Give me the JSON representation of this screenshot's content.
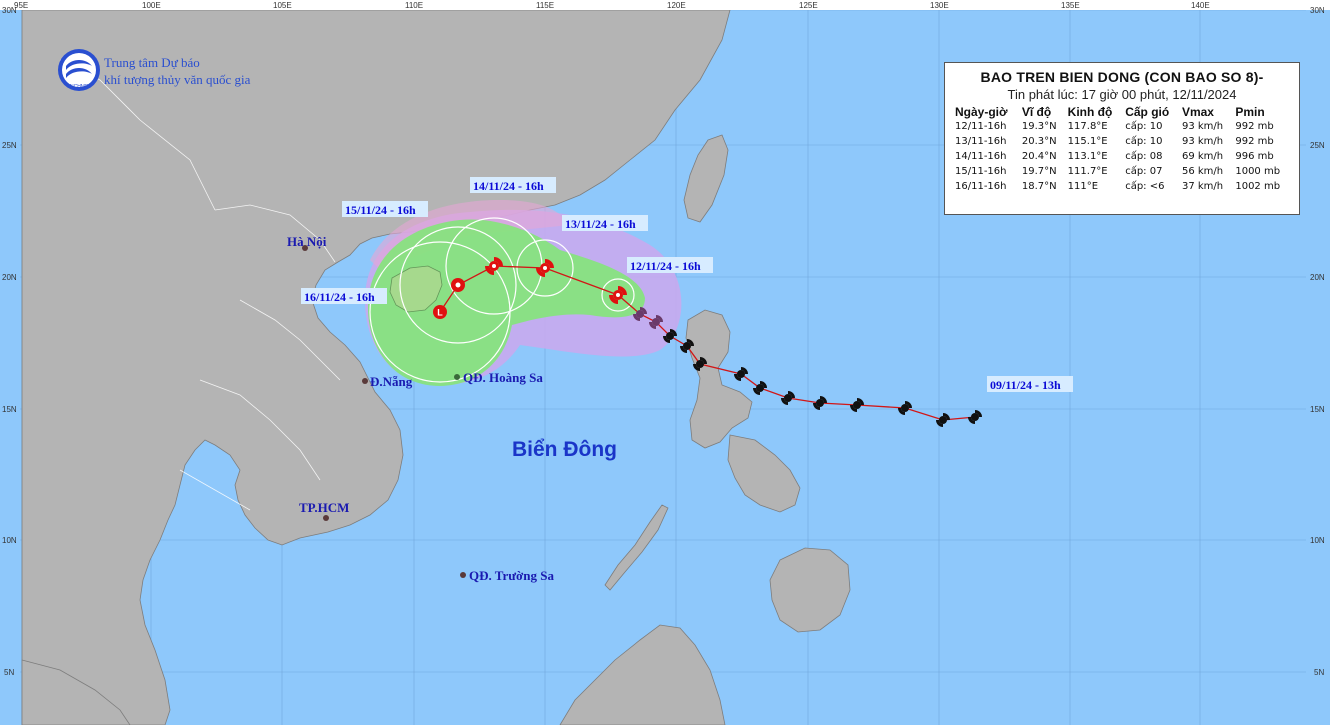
{
  "agency": {
    "line1": "Trung tâm Dự báo",
    "line2": "khí tượng thủy văn quốc gia",
    "logo_text": "NCHMF"
  },
  "info_box": {
    "title": "BAO TREN BIEN DONG (CON BAO SO 8)-",
    "subtitle": "Tin phát lúc: 17 giờ 00 phút, 12/11/2024",
    "headers": [
      "Ngày-giờ",
      "Vĩ độ",
      "Kinh độ",
      "Cấp gió",
      "Vmax",
      "Pmin"
    ],
    "rows": [
      [
        "12/11-16h",
        "19.3°N",
        "117.8°E",
        "cấp: 10",
        "93 km/h",
        "992 mb"
      ],
      [
        "13/11-16h",
        "20.3°N",
        "115.1°E",
        "cấp: 10",
        "93 km/h",
        "992 mb"
      ],
      [
        "14/11-16h",
        "20.4°N",
        "113.1°E",
        "cấp: 08",
        "69 km/h",
        "996 mb"
      ],
      [
        "15/11-16h",
        "19.7°N",
        "111.7°E",
        "cấp: 07",
        "56 km/h",
        "1000 mb"
      ],
      [
        "16/11-16h",
        "18.7°N",
        "111°E",
        "cấp: <6",
        "37 km/h",
        "1002 mb"
      ]
    ]
  },
  "sea_label": "Biển Đông",
  "places": {
    "hanoi": "Hà Nội",
    "danang": "Đ.Nẵng",
    "hoangsa": "QĐ. Hoàng Sa",
    "hcm": "TP.HCM",
    "truongsa": "QĐ. Trường Sa"
  },
  "forecast_labels": {
    "d12": "12/11/24 - 16h",
    "d13": "13/11/24 - 16h",
    "d14": "14/11/24 - 16h",
    "d15": "15/11/24 - 16h",
    "d16": "16/11/24 - 16h",
    "origin": "09/11/24 - 13h"
  },
  "lon_ticks": [
    "95E",
    "100E",
    "105E",
    "110E",
    "115E",
    "120E",
    "125E",
    "130E",
    "135E",
    "140E"
  ],
  "lat_ticks": [
    "30N",
    "25N",
    "20N",
    "15N",
    "10N",
    "5N"
  ],
  "colors": {
    "sea": "#8ec8fb",
    "land": "#b4b4b4",
    "danger_zone": "#c9a8ee",
    "wind_zone": "#86e47c",
    "track_line": "#d21616",
    "past_icon": "#111111",
    "forecast_icon": "#e01010"
  }
}
